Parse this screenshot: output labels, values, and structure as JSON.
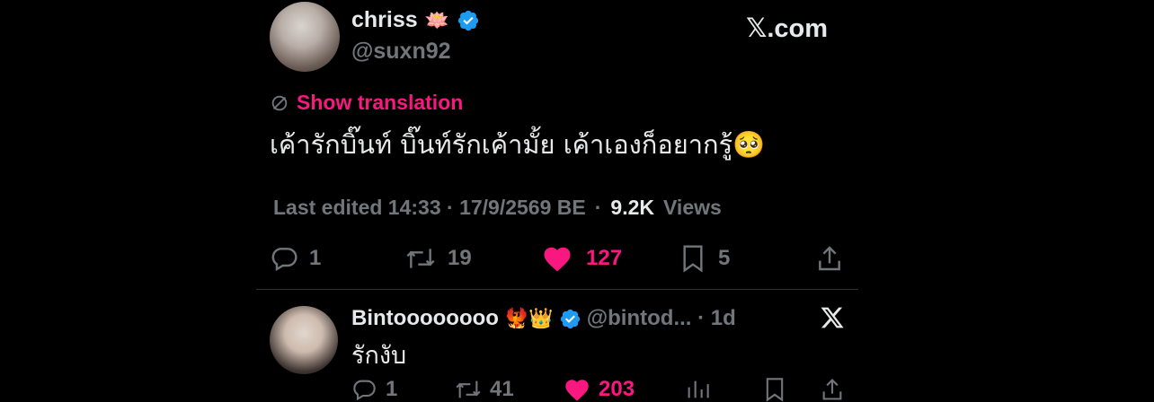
{
  "tweet": {
    "author": {
      "name": "chriss",
      "name_emoji": "🪷",
      "handle": "@suxn92"
    },
    "brand": "𝕏.com",
    "show_translation": "Show translation",
    "text": "เค้ารักบิ๊นท์ บิ๊นท์รักเค้ามั้ย เค้าเองก็อยากรู้🥺",
    "meta": {
      "edited": "Last edited 14:33 · 17/9/2569 BE",
      "separator": "·",
      "views_count": "9.2K",
      "views_label": "Views"
    },
    "actions": {
      "replies": "1",
      "reposts": "19",
      "likes": "127",
      "bookmarks": "5"
    }
  },
  "reply": {
    "author": {
      "name": "Bintoooooooo",
      "emojis": "🐦‍🔥👑",
      "handle_time": "@bintod... · 1d"
    },
    "text": "รักงับ",
    "actions": {
      "replies": "1",
      "reposts": "41",
      "likes": "203"
    }
  },
  "colors": {
    "background": "#000000",
    "verified": "#1d9bf0",
    "like": "#f91880",
    "muted": "#71767b",
    "text": "#e7e9ea"
  }
}
